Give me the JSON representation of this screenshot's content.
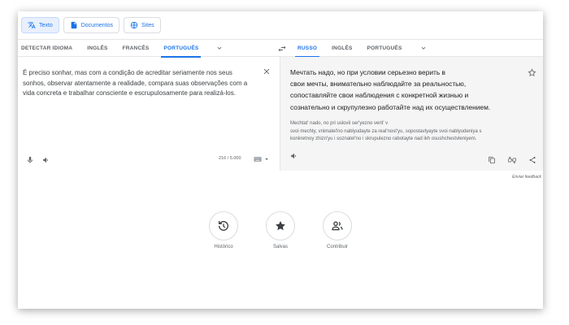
{
  "modes": [
    {
      "label": "Texto",
      "icon": "translate-icon",
      "active": true
    },
    {
      "label": "Documentos",
      "icon": "document-icon",
      "active": false
    },
    {
      "label": "Sites",
      "icon": "globe-icon",
      "active": false
    }
  ],
  "source_langs": [
    "DETECTAR IDIOMA",
    "INGLÊS",
    "FRANCÊS",
    "PORTUGUÊS"
  ],
  "source_selected": "PORTUGUÊS",
  "target_langs": [
    "RUSSO",
    "INGLÊS",
    "PORTUGUÊS"
  ],
  "target_selected": "RUSSO",
  "source": {
    "text": "É preciso sonhar, mas com a condição de acreditar seriamente nos seus sonhos, observar atentamente a realidade, compara suas observações com a vida concreta e trabalhar consciente e escrupulosamente para realizá-los.",
    "char_count": "216 / 5.000"
  },
  "translation": {
    "text_lines": [
      "Мечтать надо, но при условии серьезно верить в",
      "свои мечты, внимательно наблюдайте за реальностью,",
      "сопоставляйте свои наблюдения с конкретной жизнью и",
      "сознательно и скрупулезно работайте над их осуществлением."
    ],
    "translit_lines": [
      "Mechtat' nado, no pri uslovii ser'yezno verit' v",
      "svoi mechty, vnimatel'no nablyudayte za real'nost'yu, sopostavlyayte svoi nablyudeniya s",
      "konkretnoy zhizn'yu i soznatel'no i skrupulezno rabotayte nad ikh osushchestvleniyem."
    ]
  },
  "feedback_label": "Enviar feedback",
  "history": [
    {
      "label": "Histórico",
      "icon": "history-icon"
    },
    {
      "label": "Salvas",
      "icon": "star-filled-icon"
    },
    {
      "label": "Contribuir",
      "icon": "contribute-icon"
    }
  ],
  "colors": {
    "accent": "#1a73e8",
    "text": "#3c4043",
    "muted": "#5f6368"
  }
}
